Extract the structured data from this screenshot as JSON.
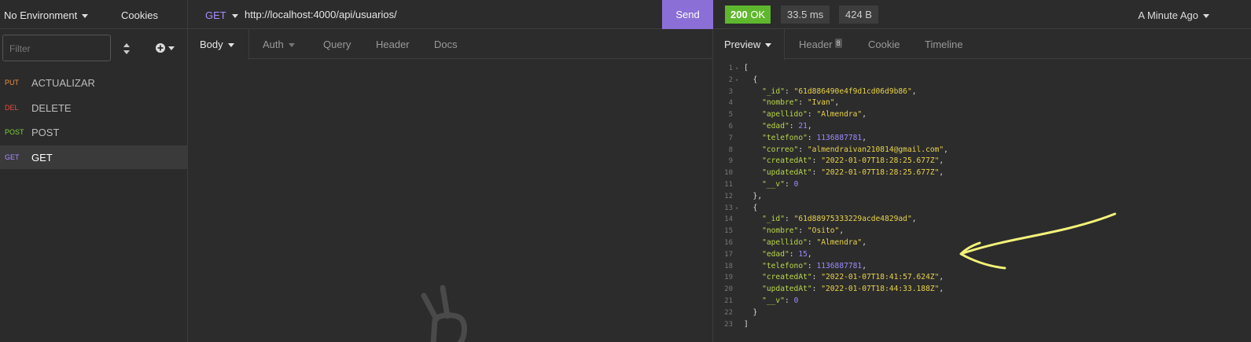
{
  "sidebar": {
    "environment": "No Environment",
    "cookies": "Cookies",
    "filter_placeholder": "Filter",
    "requests": [
      {
        "method": "PUT",
        "name": "ACTUALIZAR",
        "color": "#f0903c"
      },
      {
        "method": "DEL",
        "name": "DELETE",
        "color": "#e84a3f"
      },
      {
        "method": "POST",
        "name": "POST",
        "color": "#7dcf3a"
      },
      {
        "method": "GET",
        "name": "GET",
        "color": "#a88bff"
      }
    ]
  },
  "request": {
    "method": "GET",
    "url": "http://localhost:4000/api/usuarios/",
    "send": "Send",
    "tabs": [
      "Body",
      "Auth",
      "Query",
      "Header",
      "Docs"
    ]
  },
  "response": {
    "status_code": "200",
    "status_text": "OK",
    "time": "33.5 ms",
    "size": "424 B",
    "ago": "A Minute Ago",
    "tabs": [
      "Preview",
      "Header",
      "Cookie",
      "Timeline"
    ],
    "header_count": "8",
    "lines": [
      {
        "n": "1",
        "fold": true,
        "t": "["
      },
      {
        "n": "2",
        "fold": true,
        "t": "  {"
      },
      {
        "n": "3",
        "k": "\"_id\"",
        "v": "\"61d886490e4f9d1cd06d9b86\"",
        "vt": "s",
        "end": ","
      },
      {
        "n": "4",
        "k": "\"nombre\"",
        "v": "\"Ivan\"",
        "vt": "s",
        "end": ","
      },
      {
        "n": "5",
        "k": "\"apellido\"",
        "v": "\"Almendra\"",
        "vt": "s",
        "end": ","
      },
      {
        "n": "6",
        "k": "\"edad\"",
        "v": "21",
        "vt": "n",
        "end": ","
      },
      {
        "n": "7",
        "k": "\"telefono\"",
        "v": "1136887781",
        "vt": "n",
        "end": ","
      },
      {
        "n": "8",
        "k": "\"correo\"",
        "v": "\"almendraivan210814@gmail.com\"",
        "vt": "s",
        "end": ","
      },
      {
        "n": "9",
        "k": "\"createdAt\"",
        "v": "\"2022-01-07T18:28:25.677Z\"",
        "vt": "s",
        "end": ","
      },
      {
        "n": "10",
        "k": "\"updatedAt\"",
        "v": "\"2022-01-07T18:28:25.677Z\"",
        "vt": "s",
        "end": ","
      },
      {
        "n": "11",
        "k": "\"__v\"",
        "v": "0",
        "vt": "n",
        "end": ""
      },
      {
        "n": "12",
        "t": "  },"
      },
      {
        "n": "13",
        "fold": true,
        "t": "  {"
      },
      {
        "n": "14",
        "k": "\"_id\"",
        "v": "\"61d88975333229acde4829ad\"",
        "vt": "s",
        "end": ","
      },
      {
        "n": "15",
        "k": "\"nombre\"",
        "v": "\"Osito\"",
        "vt": "s",
        "end": ","
      },
      {
        "n": "16",
        "k": "\"apellido\"",
        "v": "\"Almendra\"",
        "vt": "s",
        "end": ","
      },
      {
        "n": "17",
        "k": "\"edad\"",
        "v": "15",
        "vt": "n",
        "end": ","
      },
      {
        "n": "18",
        "k": "\"telefono\"",
        "v": "1136887781",
        "vt": "n",
        "end": ","
      },
      {
        "n": "19",
        "k": "\"createdAt\"",
        "v": "\"2022-01-07T18:41:57.624Z\"",
        "vt": "s",
        "end": ","
      },
      {
        "n": "20",
        "k": "\"updatedAt\"",
        "v": "\"2022-01-07T18:44:33.188Z\"",
        "vt": "s",
        "end": ","
      },
      {
        "n": "21",
        "k": "\"__v\"",
        "v": "0",
        "vt": "n",
        "end": ""
      },
      {
        "n": "22",
        "t": "  }"
      },
      {
        "n": "23",
        "t": "]"
      }
    ]
  },
  "colors": {
    "accent": "#8b6ed6",
    "status_ok": "#5fb72d",
    "annotation": "#f2f27a"
  }
}
